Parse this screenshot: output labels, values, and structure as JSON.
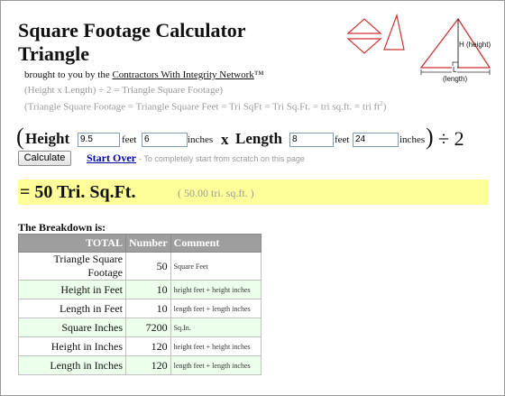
{
  "title": {
    "line1": "Square Footage Calculator",
    "line2": "Triangle"
  },
  "byline": {
    "prefix": "brought to you by the",
    "link": "Contractors With Integrity Network",
    "suffix": "™"
  },
  "formulas": {
    "line1": "(Height x Length) ÷ 2 = Triangle Square Footage)",
    "line2": "(Triangle Square Footage = Triangle Square Feet = Tri SqFt = Tri Sq.Ft. = tri sq.ft. = tri ft",
    "line2_sup": "2",
    "line2_end": ")"
  },
  "inputs": {
    "open_paren": "(",
    "height_label": "Height",
    "height_feet": "9.5",
    "height_inches": "6",
    "feet_unit": "feet",
    "inches_unit": "inches",
    "times": "x",
    "length_label": "Length",
    "length_feet": "8",
    "length_inches": "24",
    "close_paren": ")",
    "divide": "÷ 2"
  },
  "actions": {
    "calculate": "Calculate",
    "start_over": "Start Over",
    "hint": "- To completely start from scratch on this page"
  },
  "result": {
    "main": "= 50 Tri. Sq.Ft.",
    "sub": "( 50.00 tri. sq.ft. )"
  },
  "breakdown": {
    "heading": "The Breakdown is:",
    "columns": [
      "TOTAL",
      "Number",
      "Comment"
    ],
    "rows": [
      {
        "label": "Triangle Square Footage",
        "number": "50",
        "comment": "Square Feet"
      },
      {
        "label": "Height in Feet",
        "number": "10",
        "comment": "height feet + height inches"
      },
      {
        "label": "Length in Feet",
        "number": "10",
        "comment": "length feet + length inches"
      },
      {
        "label": "Square Inches",
        "number": "7200",
        "comment": "Sq.In."
      },
      {
        "label": "Height in Inches",
        "number": "120",
        "comment": "height feet + height inches"
      },
      {
        "label": "Length in Inches",
        "number": "120",
        "comment": "length feet + length inches"
      }
    ]
  },
  "diagram": {
    "height_label": "H (height)",
    "length_label": "L",
    "length_caption": "(length)"
  },
  "colors": {
    "triangle_red": "#cc3333",
    "result_bg": "#ffff99",
    "header_gray": "#9e9e9e",
    "row_green": "#ebffeb",
    "link_blue": "#0000aa"
  }
}
